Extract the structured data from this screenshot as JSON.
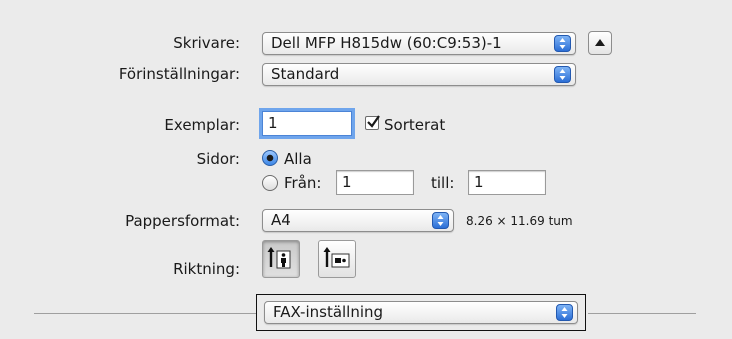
{
  "printer": {
    "label": "Skrivare:",
    "value": "Dell MFP H815dw (60:C9:53)-1"
  },
  "presets": {
    "label": "Förinställningar:",
    "value": "Standard"
  },
  "copies": {
    "label": "Exemplar:",
    "value": "1",
    "collate_label": "Sorterat",
    "collate_checked": true
  },
  "pages": {
    "label": "Sidor:",
    "all_label": "Alla",
    "from_label": "Från:",
    "from_value": "1",
    "to_label": "till:",
    "to_value": "1",
    "selected": "all"
  },
  "paper_size": {
    "label": "Pappersformat:",
    "value": "A4",
    "dimensions": "8.26 × 11.69 tum"
  },
  "orientation": {
    "label": "Riktning:",
    "options": [
      "portrait-icon",
      "landscape-icon"
    ],
    "selected": "portrait"
  },
  "section": {
    "value": "FAX-inställning"
  },
  "colors": {
    "accent": "#3c86e6",
    "background": "#ebebeb"
  }
}
